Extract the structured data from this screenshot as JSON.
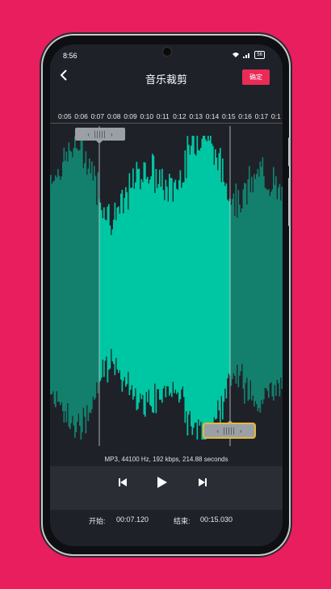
{
  "status": {
    "time": "8:56",
    "battery": "56"
  },
  "header": {
    "title": "音乐裁剪",
    "confirm_label": "确定"
  },
  "ruler": [
    "0:05",
    "0:06",
    "0:07",
    "0:08",
    "0:09",
    "0:10",
    "0:11",
    "0:12",
    "0:13",
    "0:14",
    "0:15",
    "0:16",
    "0:17",
    "0:1"
  ],
  "handles": {
    "left_arrow": "‹",
    "right_arrow": "›"
  },
  "audio_info": "MP3, 44100 Hz, 192 kbps, 214.88 seconds",
  "times": {
    "start_label": "开始:",
    "start_value": "00:07.120",
    "end_label": "结束:",
    "end_value": "00:15.030"
  },
  "colors": {
    "background": "#e91e5f",
    "wave_selected": "#00c7a3",
    "wave_unselected": "#13806d",
    "confirm": "#ea2b58",
    "handle_highlight": "#e7b93a"
  },
  "icons": {
    "previous": "skip-previous-icon",
    "play": "play-icon",
    "next": "skip-next-icon"
  }
}
